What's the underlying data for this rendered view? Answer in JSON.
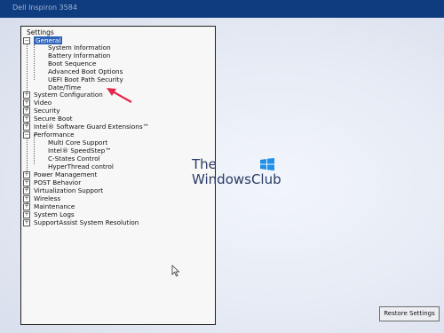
{
  "window": {
    "title": "Dell Inspiron 3584"
  },
  "settings_panel": {
    "title": "Settings",
    "general": {
      "label": "General",
      "children": [
        "System Information",
        "Battery Information",
        "Boot Sequence",
        "Advanced Boot Options",
        "UEFI Boot Path Security",
        "Date/Time"
      ]
    },
    "collapsed_group_1": [
      "System Configuration",
      "Video",
      "Security",
      "Secure Boot",
      "Intel® Software Guard Extensions™"
    ],
    "performance": {
      "label": "Performance",
      "children": [
        "Multi Core Support",
        "Intel® SpeedStep™",
        "C-States Control",
        "HyperThread control"
      ]
    },
    "collapsed_group_2": [
      "Power Management",
      "POST Behavior",
      "Virtualization Support",
      "Wireless",
      "Maintenance",
      "System Logs",
      "SupportAssist System Resolution"
    ]
  },
  "watermark": {
    "line1": "The",
    "line2": "WindowsClub"
  },
  "buttons": {
    "restore": "Restore Settings"
  },
  "colors": {
    "accent": "#2d63b8",
    "arrow": "#e3264a",
    "titlebar": "#0f3c7e"
  }
}
